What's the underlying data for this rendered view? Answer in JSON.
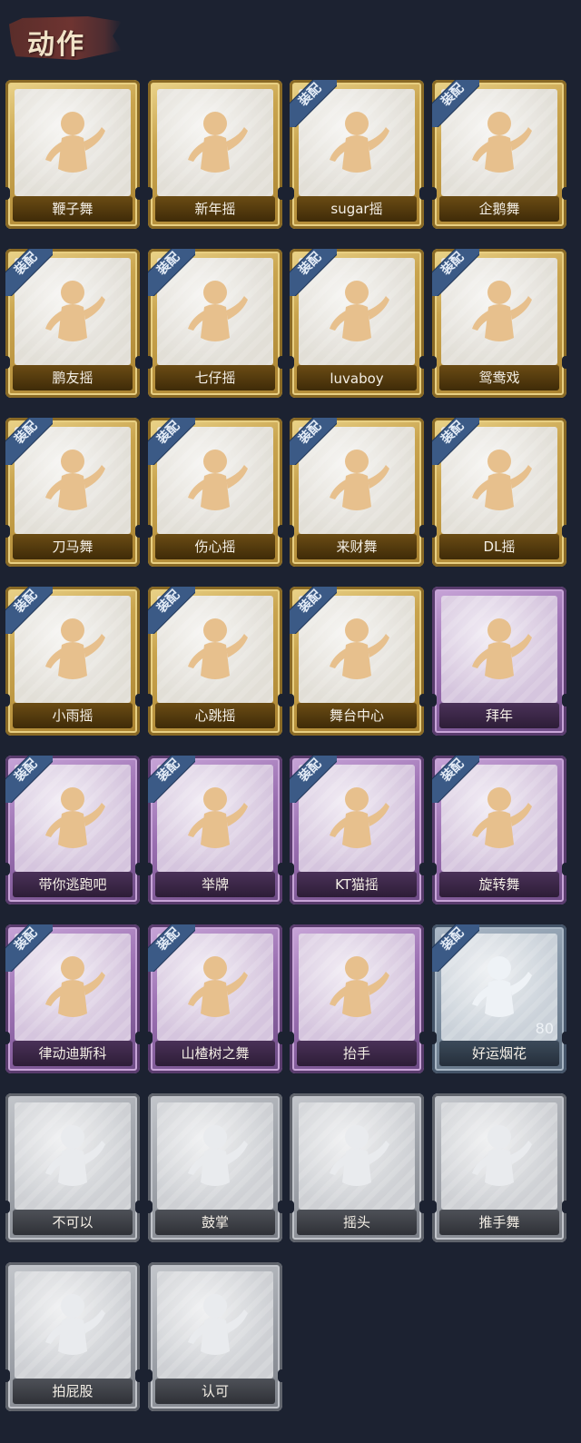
{
  "header": {
    "title": "动作"
  },
  "badge_label": "装配",
  "cards": [
    {
      "label": "鞭子舞",
      "tier": "gold",
      "equipped": false,
      "icon": "whip-dance-icon"
    },
    {
      "label": "新年摇",
      "tier": "gold",
      "equipped": false,
      "icon": "new-year-sway-icon"
    },
    {
      "label": "sugar摇",
      "tier": "gold",
      "equipped": true,
      "icon": "sugar-sway-icon"
    },
    {
      "label": "企鹅舞",
      "tier": "gold",
      "equipped": true,
      "icon": "penguin-dance-icon"
    },
    {
      "label": "鹏友摇",
      "tier": "gold",
      "equipped": true,
      "icon": "friend-sway-icon"
    },
    {
      "label": "七仔摇",
      "tier": "gold",
      "equipped": true,
      "icon": "qizai-sway-icon"
    },
    {
      "label": "luvaboy",
      "tier": "gold",
      "equipped": true,
      "icon": "luvaboy-icon"
    },
    {
      "label": "鸳鸯戏",
      "tier": "gold",
      "equipped": true,
      "icon": "mandarin-duck-icon"
    },
    {
      "label": "刀马舞",
      "tier": "gold",
      "equipped": true,
      "icon": "blade-horse-dance-icon"
    },
    {
      "label": "伤心摇",
      "tier": "gold",
      "equipped": true,
      "icon": "heartbreak-sway-icon"
    },
    {
      "label": "来财舞",
      "tier": "gold",
      "equipped": true,
      "icon": "fortune-dance-icon"
    },
    {
      "label": "DL摇",
      "tier": "gold",
      "equipped": true,
      "icon": "dl-sway-icon"
    },
    {
      "label": "小雨摇",
      "tier": "gold",
      "equipped": true,
      "icon": "light-rain-sway-icon"
    },
    {
      "label": "心跳摇",
      "tier": "gold",
      "equipped": true,
      "icon": "heartbeat-sway-icon"
    },
    {
      "label": "舞台中心",
      "tier": "gold",
      "equipped": true,
      "icon": "center-stage-icon"
    },
    {
      "label": "拜年",
      "tier": "purple",
      "equipped": false,
      "icon": "new-year-greeting-icon"
    },
    {
      "label": "带你逃跑吧",
      "tier": "purple",
      "equipped": true,
      "icon": "run-away-icon"
    },
    {
      "label": "举牌",
      "tier": "purple",
      "equipped": true,
      "icon": "hold-sign-icon"
    },
    {
      "label": "KT猫摇",
      "tier": "purple",
      "equipped": true,
      "icon": "kt-cat-sway-icon"
    },
    {
      "label": "旋转舞",
      "tier": "purple",
      "equipped": true,
      "icon": "spin-dance-icon"
    },
    {
      "label": "律动迪斯科",
      "tier": "purple",
      "equipped": true,
      "icon": "disco-icon"
    },
    {
      "label": "山楂树之舞",
      "tier": "purple",
      "equipped": true,
      "icon": "hawthorn-dance-icon"
    },
    {
      "label": "抬手",
      "tier": "purple",
      "equipped": false,
      "icon": "raise-hand-icon"
    },
    {
      "label": "好运烟花",
      "tier": "blue",
      "equipped": true,
      "icon": "firework-icon",
      "count": "80"
    },
    {
      "label": "不可以",
      "tier": "gray",
      "equipped": false,
      "icon": "finger-no-icon"
    },
    {
      "label": "鼓掌",
      "tier": "gray",
      "equipped": false,
      "icon": "clap-icon"
    },
    {
      "label": "摇头",
      "tier": "gray",
      "equipped": false,
      "icon": "shake-head-icon"
    },
    {
      "label": "推手舞",
      "tier": "gray",
      "equipped": false,
      "icon": "push-hands-dance-icon"
    },
    {
      "label": "拍屁股",
      "tier": "gray",
      "equipped": false,
      "icon": "pat-bottom-icon"
    },
    {
      "label": "认可",
      "tier": "gray",
      "equipped": false,
      "icon": "thumbs-up-icon"
    }
  ]
}
